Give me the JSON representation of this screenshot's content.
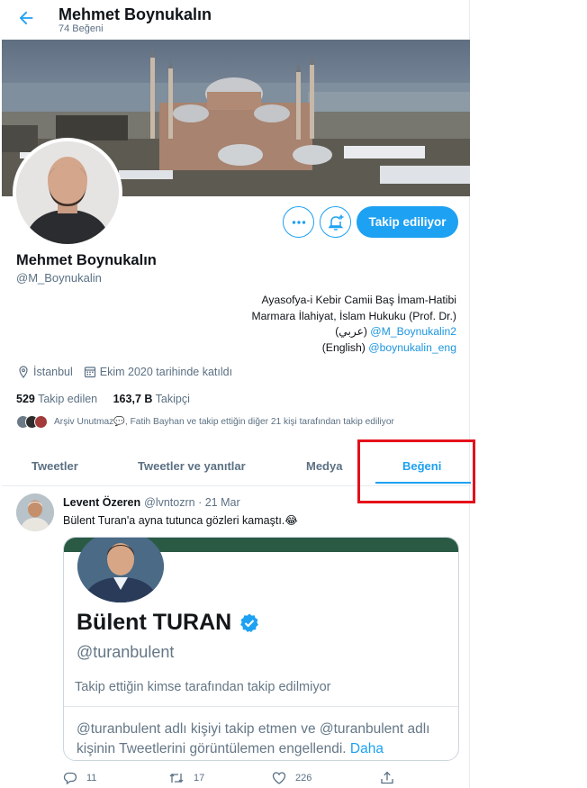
{
  "header": {
    "back_icon": "arrow-left-icon",
    "title": "Mehmet Boynukalın",
    "subtitle": "74 Beğeni"
  },
  "profile": {
    "display_name": "Mehmet Boynukalın",
    "handle": "@M_Boynukalin",
    "more_icon": "more-horizontal-icon",
    "notify_icon": "bell-plus-icon",
    "follow_button": "Takip ediliyor",
    "bio": {
      "line1": "Ayasofya-i Kebir Camii Baş İmam-Hatibi",
      "line2": "Marmara İlahiyat, İslam Hukuku (Prof. Dr.)",
      "line3_prefix": "(عربي)",
      "line3_link": "@M_Boynukalin2",
      "line4_prefix": "(English)",
      "line4_link": "@boynukalin_eng"
    },
    "location": "İstanbul",
    "joined": "Ekim 2020 tarihinde katıldı",
    "following_count": "529",
    "following_label": "Takip edilen",
    "followers_count": "163,7 B",
    "followers_label": "Takipçi",
    "known_followers": "Arşiv Unutmaz💬, Fatih Bayhan ve takip ettiğin diğer 21 kişi tarafından takip ediliyor"
  },
  "tabs": [
    {
      "label": "Tweetler"
    },
    {
      "label": "Tweetler ve yanıtlar"
    },
    {
      "label": "Medya"
    },
    {
      "label": "Beğeni"
    }
  ],
  "tweet": {
    "author": "Levent Özeren",
    "handle_time": "@lvntozrn · 21 Mar",
    "text": "Bülent Turan'a ayna tutunca gözleri kamaştı.😂",
    "card": {
      "name": "Bülent TURAN",
      "handle": "@turanbulent",
      "note": "Takip ettiğin kimse tarafından takip edilmiyor",
      "blocked_text": "@turanbulent adlı kişiyi takip etmen ve @turanbulent adlı kişinin Tweetlerini görüntülemen engellendi.",
      "more_link": "Daha"
    },
    "replies": "11",
    "retweets": "17",
    "likes": "226"
  },
  "colors": {
    "accent": "#1da1f2",
    "highlight": "#e5101a"
  }
}
